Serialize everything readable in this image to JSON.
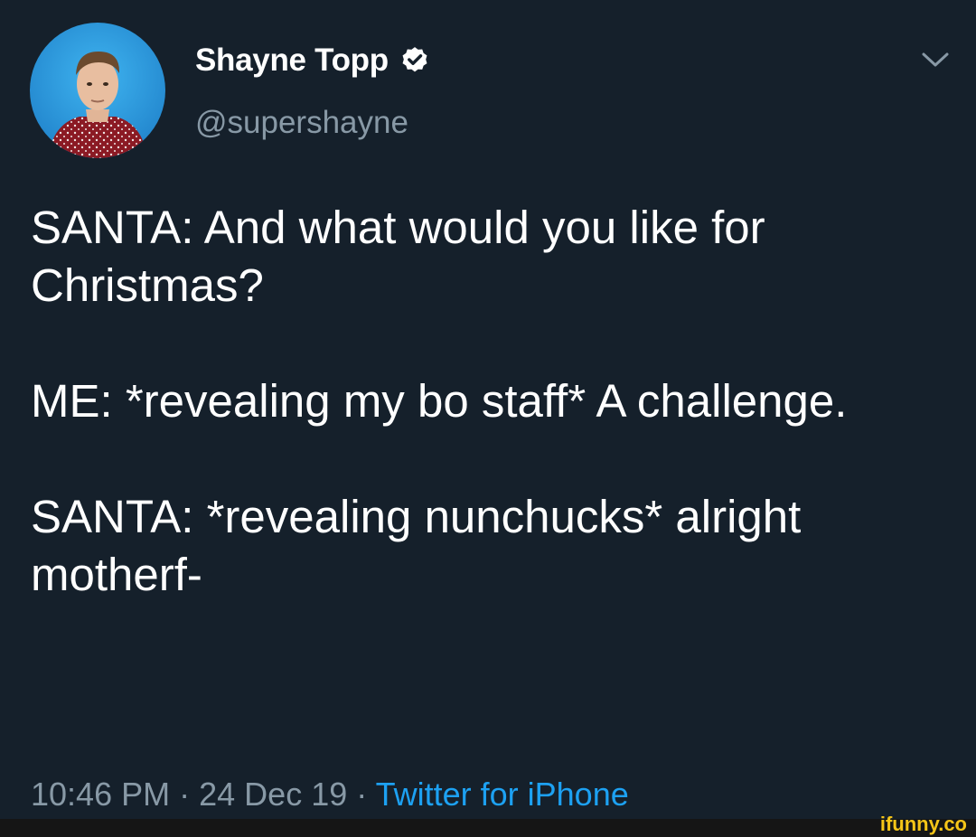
{
  "author": {
    "display_name": "Shayne Topp",
    "handle": "@supershayne"
  },
  "tweet": {
    "paragraphs": [
      "SANTA: And what would you like for Christmas?",
      "ME: *revealing my bo staff* A challenge.",
      "SANTA: *revealing nunchucks* alright motherf-"
    ],
    "time": "10:46 PM",
    "date": "24 Dec 19",
    "separator": "·",
    "source": "Twitter for iPhone"
  },
  "watermark": {
    "text": "ifunny.co"
  },
  "colors": {
    "background": "#15202b",
    "primary_text": "#ffffff",
    "secondary_text": "#8899a6",
    "accent": "#1da1f2",
    "watermark": "#f5c518"
  },
  "icons": {
    "verified": "verified-badge-icon",
    "menu": "chevron-down-icon"
  }
}
